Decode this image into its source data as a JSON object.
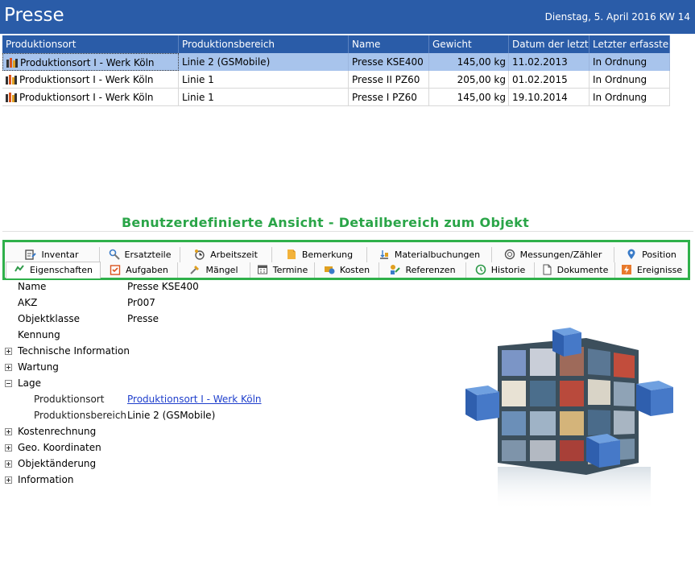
{
  "header": {
    "title": "Presse",
    "date": "Dienstag, 5. April 2016  KW 14"
  },
  "grid": {
    "columns": [
      "Produktionsort",
      "Produktionsbereich",
      "Name",
      "Gewicht",
      "Datum der letzt...",
      "Letzter erfasster..."
    ],
    "rows": [
      [
        "Produktionsort I - Werk Köln",
        "Linie 2 (GSMobile)",
        "Presse KSE400",
        "145,00 kg",
        "11.02.2013",
        "In Ordnung"
      ],
      [
        "Produktionsort I - Werk Köln",
        "Linie 1",
        "Presse II PZ60",
        "205,00 kg",
        "01.02.2015",
        "In Ordnung"
      ],
      [
        "Produktionsort I - Werk Köln",
        "Linie 1",
        "Presse I PZ60",
        "145,00 kg",
        "19.10.2014",
        "In Ordnung"
      ]
    ]
  },
  "caption": "Benutzerdefinierte Ansicht - Detailbereich zum Objekt",
  "tabs": {
    "top": [
      {
        "label": "Inventar",
        "icon": "inventory-icon"
      },
      {
        "label": "Ersatzteile",
        "icon": "spare-parts-icon"
      },
      {
        "label": "Arbeitszeit",
        "icon": "work-time-icon"
      },
      {
        "label": "Bemerkung",
        "icon": "note-icon"
      },
      {
        "label": "Materialbuchungen",
        "icon": "material-icon"
      },
      {
        "label": "Messungen/Zähler",
        "icon": "meter-icon"
      },
      {
        "label": "Position",
        "icon": "location-pin-icon"
      }
    ],
    "bottom": [
      {
        "label": "Eigenschaften",
        "icon": "properties-icon"
      },
      {
        "label": "Aufgaben",
        "icon": "task-icon"
      },
      {
        "label": "Mängel",
        "icon": "defect-icon"
      },
      {
        "label": "Termine",
        "icon": "calendar-icon"
      },
      {
        "label": "Kosten",
        "icon": "costs-icon"
      },
      {
        "label": "Referenzen",
        "icon": "references-icon"
      },
      {
        "label": "Historie",
        "icon": "history-icon"
      },
      {
        "label": "Dokumente",
        "icon": "document-icon"
      },
      {
        "label": "Ereignisse",
        "icon": "event-icon"
      }
    ]
  },
  "details": {
    "name_label": "Name",
    "name_value": "Presse KSE400",
    "akz_label": "AKZ",
    "akz_value": "Pr007",
    "klasse_label": "Objektklasse",
    "klasse_value": "Presse",
    "kennung_label": "Kennung",
    "technische_label": "Technische Information",
    "wartung_label": "Wartung",
    "lage_label": "Lage",
    "produktionsort_label": "Produktionsort",
    "produktionsort_value": "Produktionsort I - Werk Köln",
    "produktionsbereich_label": "Produktionsbereich",
    "produktionsbereich_value": "Linie 2 (GSMobile)",
    "kosten_label": "Kostenrechnung",
    "geo_label": "Geo. Koordinaten",
    "aenderung_label": "Objektänderung",
    "information_label": "Information"
  },
  "colors": {
    "header": "#2a5ca8",
    "selected_row": "#a8c4ec",
    "caption": "#2aa548",
    "tab_border": "#2fb04a",
    "link": "#1f3fcc"
  }
}
